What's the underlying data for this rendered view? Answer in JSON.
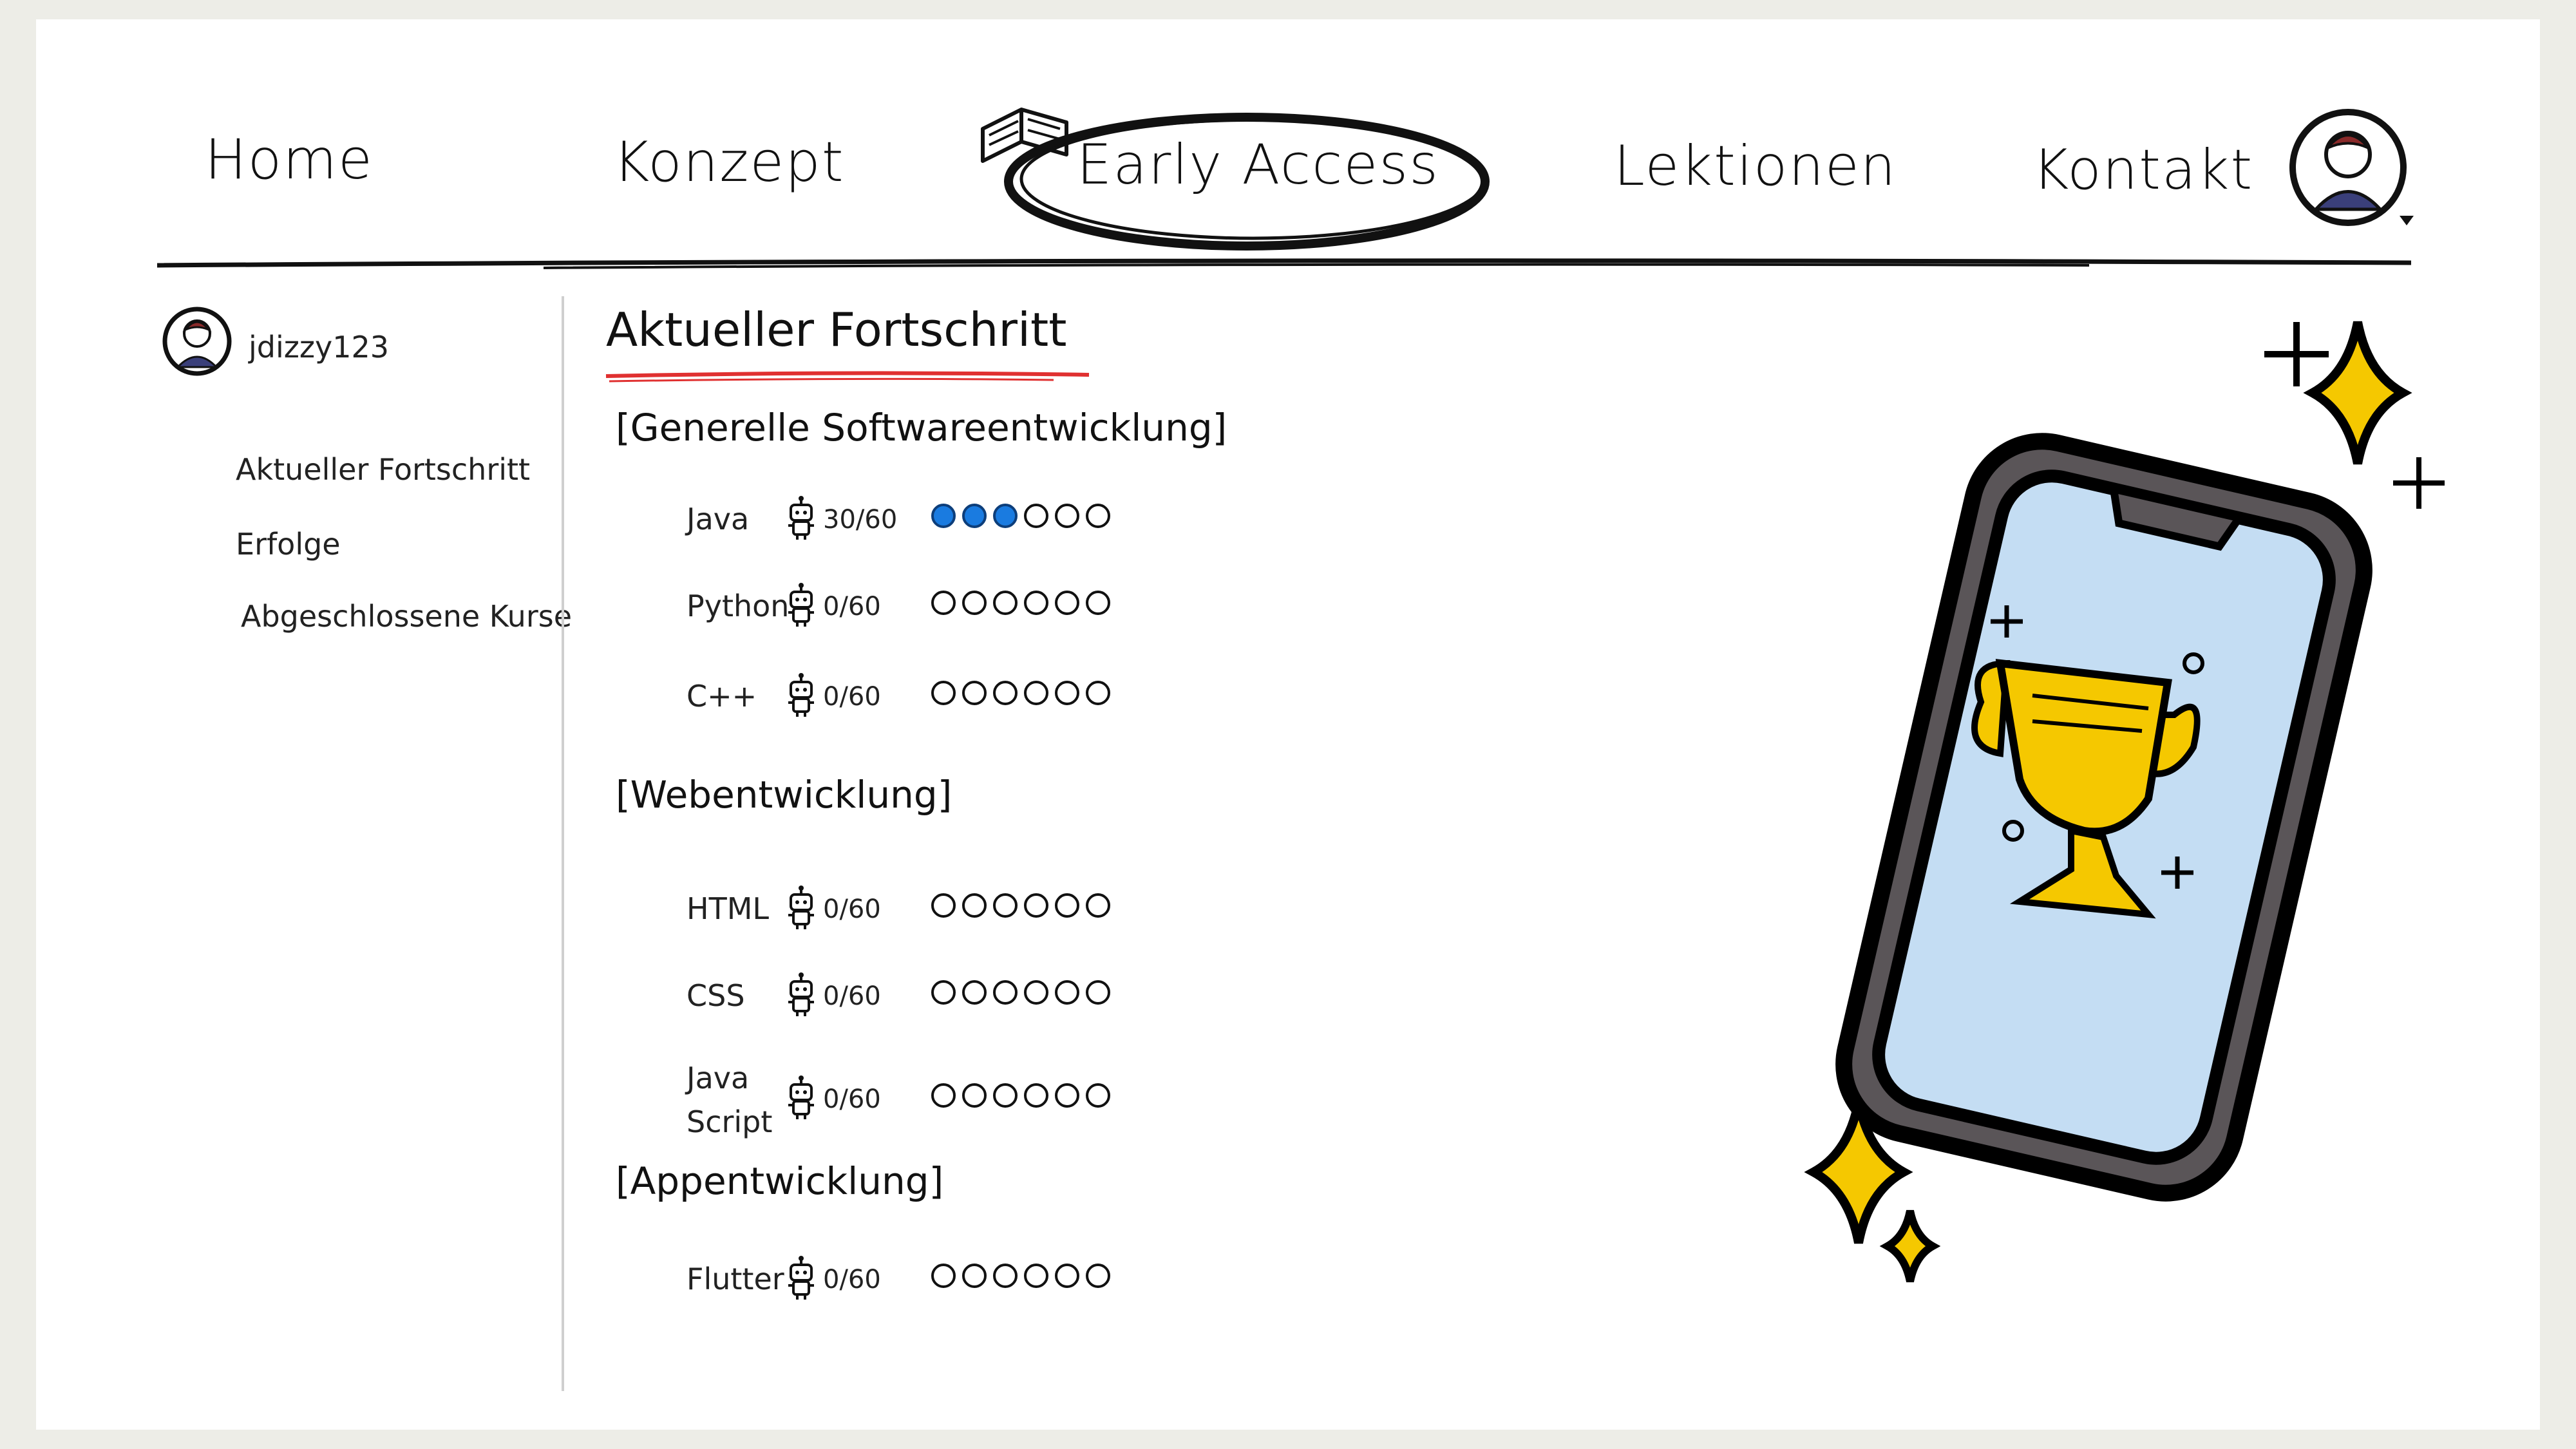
{
  "nav": {
    "items": [
      {
        "label": "Home"
      },
      {
        "label": "Konzept"
      },
      {
        "label": "Early Access"
      },
      {
        "label": "Lektionen"
      },
      {
        "label": "Kontakt"
      }
    ]
  },
  "sidebar": {
    "username": "jdizzy123",
    "links": [
      {
        "label": "Aktueller Fortschritt"
      },
      {
        "label": "Erfolge"
      },
      {
        "label": "Abgeschlossene Kurse"
      }
    ]
  },
  "main": {
    "title": "Aktueller Fortschritt",
    "sections": [
      {
        "heading": "[Generelle Softwareentwicklung]",
        "rows": [
          {
            "name": "Java",
            "score": "30/60",
            "filled": 3,
            "total": 6
          },
          {
            "name": "Python",
            "score": "0/60",
            "filled": 0,
            "total": 6
          },
          {
            "name": "C++",
            "score": "0/60",
            "filled": 0,
            "total": 6
          }
        ]
      },
      {
        "heading": "[Webentwicklung]",
        "rows": [
          {
            "name": "HTML",
            "score": "0/60",
            "filled": 0,
            "total": 6
          },
          {
            "name": "CSS",
            "score": "0/60",
            "filled": 0,
            "total": 6
          },
          {
            "name": "Java Script",
            "score": "0/60",
            "filled": 0,
            "total": 6
          }
        ]
      },
      {
        "heading": "[Appentwicklung]",
        "rows": [
          {
            "name": "Flutter",
            "score": "0/60",
            "filled": 0,
            "total": 6
          }
        ]
      }
    ]
  },
  "colors": {
    "progress_fill": "#1a7be0",
    "title_underline": "#e03030",
    "trophy": "#f5c800",
    "screen": "#c4ddf3",
    "phone": "#5a5558"
  },
  "icons": {
    "nav_active": "book-icon",
    "profile": "avatar-icon",
    "robot": "robot-icon",
    "trophy": "trophy-icon",
    "sparkle": "sparkle-icon"
  }
}
